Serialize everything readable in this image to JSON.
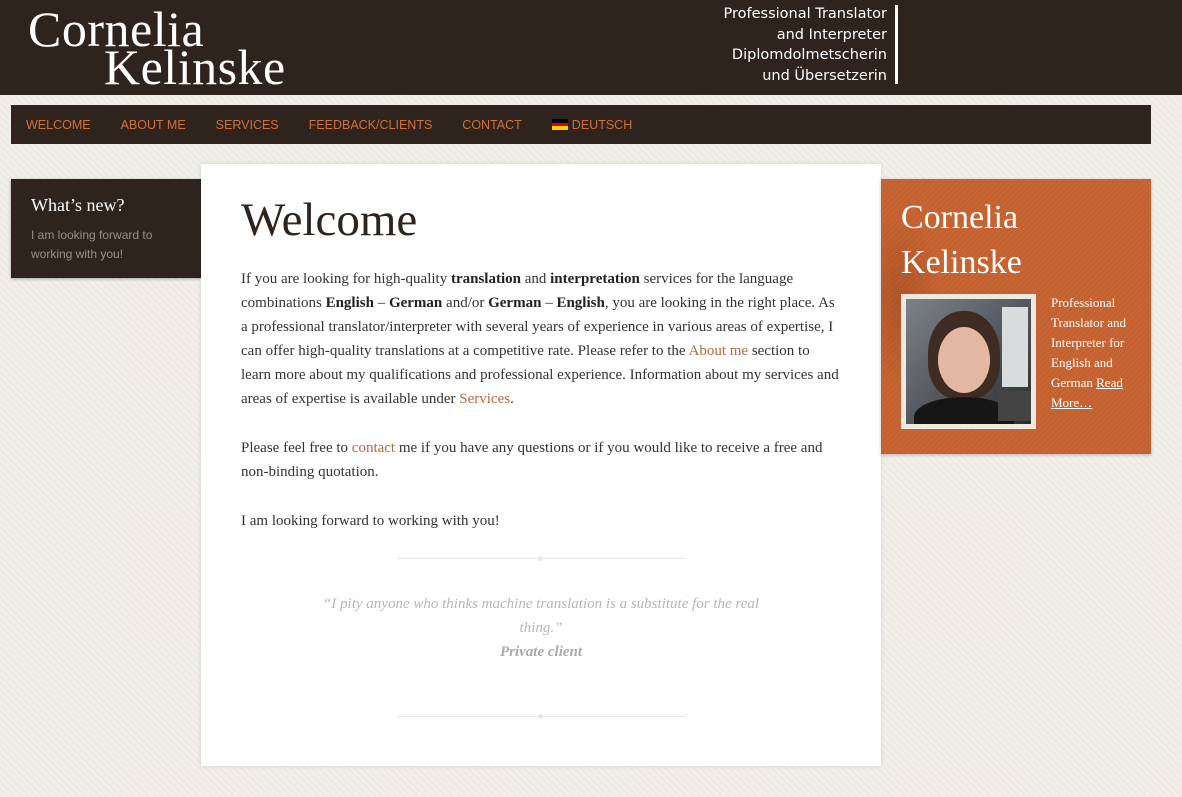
{
  "header": {
    "logo_line1": "Cornelia",
    "logo_line2": "Kelinske",
    "tagline": [
      "Professional Translator",
      "and Interpreter",
      "Diplomdolmetscherin",
      "und Übersetzerin"
    ]
  },
  "nav": {
    "items": [
      "WELCOME",
      "ABOUT ME",
      "SERVICES",
      "FEEDBACK/CLIENTS",
      "CONTACT"
    ],
    "language": "DEUTSCH",
    "flag_icon": "german-flag-icon",
    "flag_colors": [
      "#000000",
      "#dd0000",
      "#ffce00"
    ],
    "link_color": "#d0703a"
  },
  "whats_new": {
    "title": "What’s new?",
    "text": "I am looking forward to working with you!"
  },
  "content": {
    "title": "Welcome",
    "p1": {
      "t1": "If you are looking for high-quality ",
      "b1": "translation",
      "t2": " and ",
      "b2": "interpretation",
      "t3": " services for the language combinations ",
      "b3": "English",
      "t4": " – ",
      "b4": "German",
      "t5": " and/or ",
      "b5": "German",
      "t6": " – ",
      "b6": "English",
      "t7": ", you are looking in the right place. As a professional translator/interpreter with several years of experience in various areas of expertise, I can offer high-quality translations at a competitive rate. Please refer to the ",
      "link1": "About me",
      "t8": " section to learn more about my qualifications and professional experience. Information about my services and areas of expertise is available under ",
      "link2": "Services",
      "t9": "."
    },
    "p2": {
      "t1": "Please feel free to ",
      "link": "contact",
      "t2": " me if you have any questions or if you would like to receive a free and non-binding quotation."
    },
    "p3": "I am looking forward to working with you!",
    "quote": {
      "text": "“I pity anyone who thinks machine translation  is a substitute for the real thing.”",
      "source": "Private client"
    }
  },
  "profile": {
    "name": "Cornelia Kelinske",
    "bio": "Professional Translator and Interpreter for English and German ",
    "read_more": "Read More…",
    "bg_color": "#c4612f"
  }
}
